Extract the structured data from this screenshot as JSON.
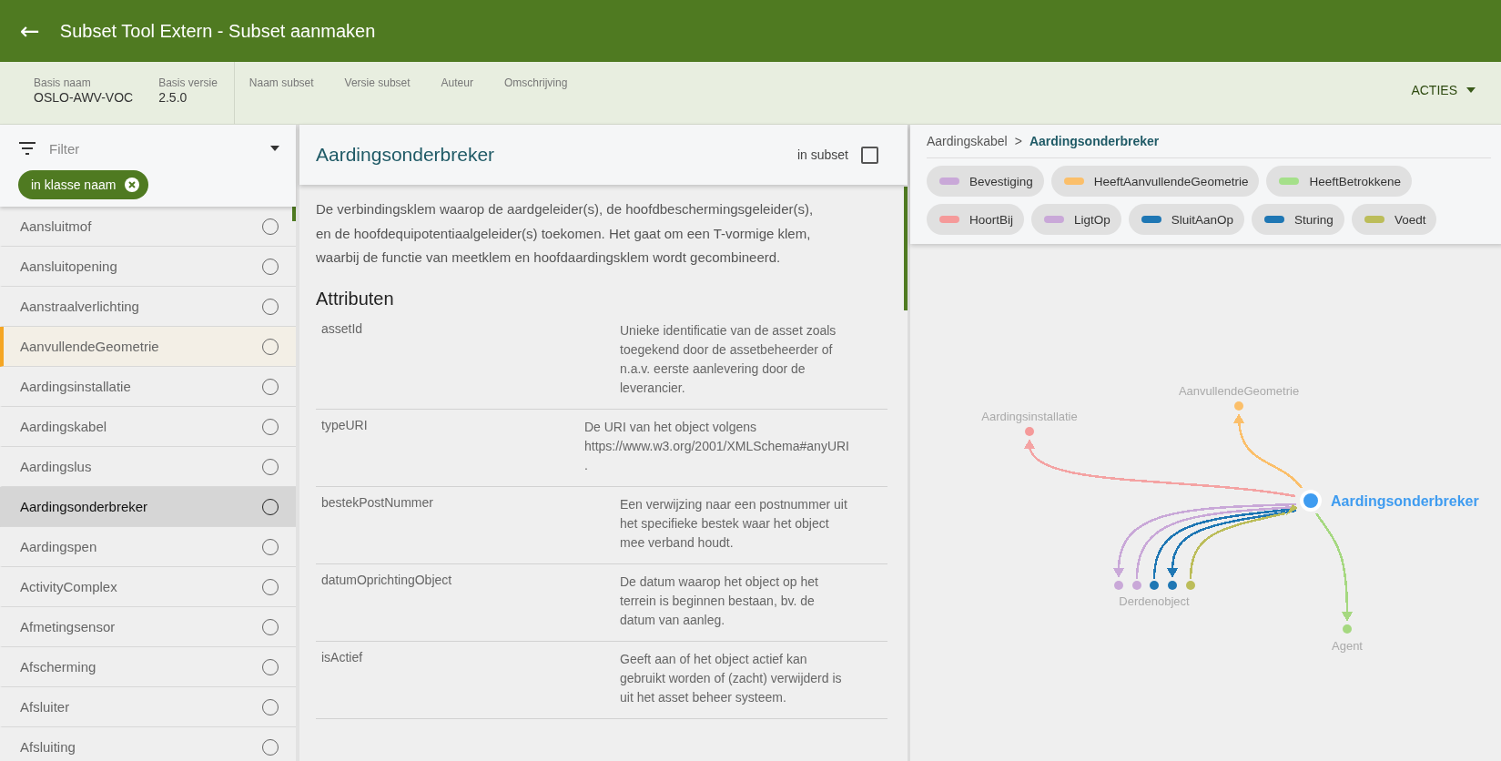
{
  "app_bar": {
    "back_icon": "←",
    "title": "Subset Tool Extern - Subset aanmaken"
  },
  "info_bar": {
    "base": [
      {
        "label": "Basis naam",
        "value": "OSLO-AWV-VOC"
      },
      {
        "label": "Basis versie",
        "value": "2.5.0"
      }
    ],
    "subset": [
      "Naam subset",
      "Versie subset",
      "Auteur",
      "Omschrijving"
    ],
    "actions": "ACTIES"
  },
  "sidebar": {
    "filter": {
      "placeholder": "Filter"
    },
    "chip": "in klasse naam",
    "items": [
      {
        "label": "Aansluitmof",
        "selected": false,
        "focused": false,
        "checked": false
      },
      {
        "label": "Aansluitopening",
        "selected": false,
        "focused": false,
        "checked": false
      },
      {
        "label": "Aanstraalverlichting",
        "selected": false,
        "focused": false,
        "checked": false
      },
      {
        "label": "AanvullendeGeometrie",
        "selected": false,
        "focused": true,
        "checked": false
      },
      {
        "label": "Aardingsinstallatie",
        "selected": false,
        "focused": false,
        "checked": false
      },
      {
        "label": "Aardingskabel",
        "selected": false,
        "focused": false,
        "checked": false
      },
      {
        "label": "Aardingslus",
        "selected": false,
        "focused": false,
        "checked": false
      },
      {
        "label": "Aardingsonderbreker",
        "selected": true,
        "focused": false,
        "checked": false
      },
      {
        "label": "Aardingspen",
        "selected": false,
        "focused": false,
        "checked": false
      },
      {
        "label": "ActivityComplex",
        "selected": false,
        "focused": false,
        "checked": false
      },
      {
        "label": "Afmetingsensor",
        "selected": false,
        "focused": false,
        "checked": false
      },
      {
        "label": "Afscherming",
        "selected": false,
        "focused": false,
        "checked": false
      },
      {
        "label": "Afsluiter",
        "selected": false,
        "focused": false,
        "checked": false
      },
      {
        "label": "Afsluiting",
        "selected": false,
        "focused": false,
        "checked": false
      }
    ]
  },
  "detail": {
    "title": "Aardingsonderbreker",
    "in_subset": {
      "label": "in subset",
      "checked": false
    },
    "description": "De verbindingsklem waarop de aardgeleider(s), de hoofdbeschermingsgeleider(s), en de hoofdequipotentiaalgeleider(s) toekomen. Het gaat om een T-vormige klem, waarbij de functie van meetklem en hoofdaardingsklem wordt gecombineerd.",
    "attributes_heading": "Attributen",
    "attributes": [
      {
        "name": "assetId",
        "description": "Unieke identificatie van de asset zoals toegekend door de assetbeheerder of n.a.v. eerste aanlevering door de leverancier."
      },
      {
        "name": "typeURI",
        "description": "De URI van het object volgens https://www.w3.org/2001/XMLSchema#anyURI ."
      },
      {
        "name": "bestekPostNummer",
        "description": "Een verwijzing naar een postnummer uit het specifieke bestek waar het object mee verband houdt."
      },
      {
        "name": "datumOprichtingObject",
        "description": "De datum waarop het object op het terrein is beginnen bestaan, bv. de datum van aanleg."
      },
      {
        "name": "isActief",
        "description": "Geeft aan of het object actief kan gebruikt worden of (zacht) verwijderd is uit het asset beheer systeem."
      }
    ]
  },
  "relations_panel": {
    "breadcrumb": [
      {
        "label": "Aardingskabel",
        "selected": false
      },
      {
        "label": "Aardingsonderbreker",
        "selected": true
      }
    ],
    "separator": ">",
    "relations": [
      {
        "label": "Bevestiging",
        "color": "#c9a8d8"
      },
      {
        "label": "HeeftAanvullendeGeometrie",
        "color": "#fbbf6a"
      },
      {
        "label": "HeeftBetrokkene",
        "color": "#a5e08a"
      },
      {
        "label": "HoortBij",
        "color": "#f59a9a"
      },
      {
        "label": "LigtOp",
        "color": "#c9a8d8"
      },
      {
        "label": "SluitAanOp",
        "color": "#1f77b4"
      },
      {
        "label": "Sturing",
        "color": "#1f77b4"
      },
      {
        "label": "Voedt",
        "color": "#bcbd5a"
      }
    ],
    "graph": {
      "nodes": [
        {
          "label": "Aardingsonderbreker",
          "kind": "focus",
          "color": "#3f9cf0"
        },
        {
          "label": "Aardingsinstallatie",
          "kind": "node",
          "color": "#f59a9a"
        },
        {
          "label": "AanvullendeGeometrie",
          "kind": "node",
          "color": "#fbbf6a"
        },
        {
          "label": "Derdenobject",
          "kind": "group",
          "dots": [
            {
              "color": "#c9a8d8"
            },
            {
              "color": "#c9a8d8"
            },
            {
              "color": "#1f77b4"
            },
            {
              "color": "#1f77b4"
            },
            {
              "color": "#bcbd5a"
            }
          ]
        },
        {
          "label": "Agent",
          "kind": "node",
          "color": "#a5d880"
        }
      ],
      "edges": [
        {
          "color": "#f4a3a3"
        },
        {
          "color": "#fbbf6a"
        },
        {
          "color": "#c9a8d8"
        },
        {
          "color": "#c9a8d8"
        },
        {
          "color": "#1f77b4"
        },
        {
          "color": "#1f77b4"
        },
        {
          "color": "#bcbd5a"
        },
        {
          "color": "#a5d880"
        }
      ]
    }
  }
}
